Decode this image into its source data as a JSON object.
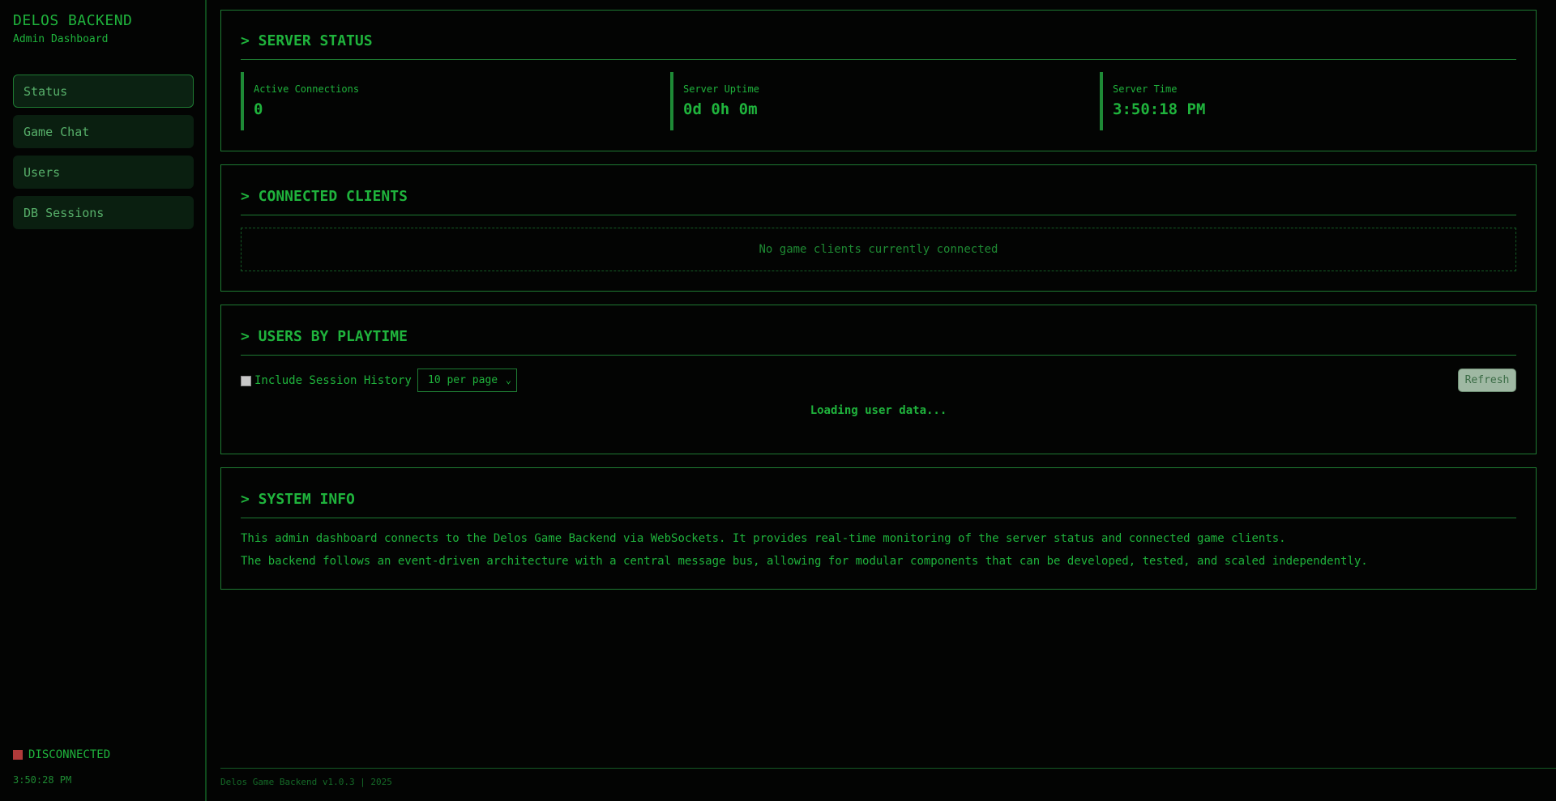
{
  "sidebar": {
    "title": "DELOS BACKEND",
    "subtitle": "Admin Dashboard",
    "nav": [
      {
        "label": "Status",
        "active": true
      },
      {
        "label": "Game Chat",
        "active": false
      },
      {
        "label": "Users",
        "active": false
      },
      {
        "label": "DB Sessions",
        "active": false
      }
    ],
    "connection_status": "DISCONNECTED",
    "connection_color": "#b03a3a",
    "clock": "3:50:28 PM"
  },
  "server_status": {
    "title": "> SERVER STATUS",
    "stats": [
      {
        "label": "Active Connections",
        "value": "0"
      },
      {
        "label": "Server Uptime",
        "value": "0d 0h 0m"
      },
      {
        "label": "Server Time",
        "value": "3:50:18 PM"
      }
    ]
  },
  "connected_clients": {
    "title": "> CONNECTED CLIENTS",
    "empty_message": "No game clients currently connected"
  },
  "users_by_playtime": {
    "title": "> USERS BY PLAYTIME",
    "include_history_label": "Include Session History",
    "include_history_checked": false,
    "per_page_selected": "10 per page",
    "refresh_label": "Refresh",
    "loading_message": "Loading user data..."
  },
  "system_info": {
    "title": "> SYSTEM INFO",
    "paragraphs": [
      "This admin dashboard connects to the Delos Game Backend via WebSockets. It provides real-time monitoring of the server status and connected game clients.",
      "The backend follows an event-driven architecture with a central message bus, allowing for modular components that can be developed, tested, and scaled independently."
    ]
  },
  "footer": {
    "text": "Delos Game Backend v1.0.3 | 2025"
  },
  "colors": {
    "accent": "#1fb33c",
    "border": "#1e7a32",
    "background": "#030403"
  }
}
